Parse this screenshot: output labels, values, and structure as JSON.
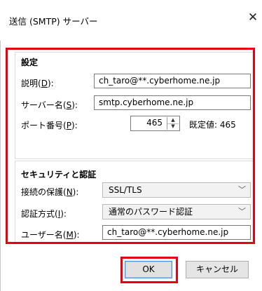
{
  "window": {
    "title": "送信 (SMTP) サーバー",
    "close_glyph": "✕"
  },
  "settings": {
    "heading": "設定",
    "description": {
      "label": "説明(",
      "key": "D",
      "suffix": "):",
      "value": "ch_taro@**.cyberhome.ne.jp"
    },
    "server_name": {
      "label": "サーバー名(",
      "key": "S",
      "suffix": "):",
      "value": "smtp.cyberhome.ne.jp"
    },
    "port": {
      "label": "ポート番号(",
      "key": "P",
      "suffix": "):",
      "value": "465",
      "default_text": "既定値:  465"
    }
  },
  "security": {
    "heading": "セキュリティと認証",
    "connection_security": {
      "label": "接続の保護(",
      "key": "N",
      "suffix": "):",
      "selected": "SSL/TLS"
    },
    "auth_method": {
      "label": "認証方式(",
      "key": "I",
      "suffix": "):",
      "selected": "通常のパスワード認証"
    },
    "username": {
      "label": "ユーザー名(",
      "key": "M",
      "suffix": "):",
      "value": "ch_taro@**.cyberhome.ne.jp"
    }
  },
  "buttons": {
    "ok": "OK",
    "cancel": "キャンセル"
  },
  "colors": {
    "highlight": "#e60012",
    "focus_border": "#4a8fd8"
  }
}
